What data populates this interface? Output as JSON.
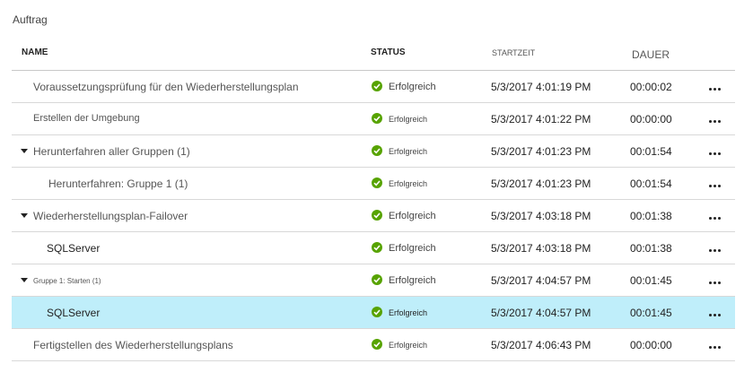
{
  "title": "Auftrag",
  "columns": {
    "name": "NAME",
    "status": "STATUS",
    "start": "STARTZEIT",
    "duration": "DAUER"
  },
  "rows": [
    {
      "name": "Voraussetzungsprüfung für den Wiederherstellungsplan",
      "status": "Erfolgreich",
      "start": "5/3/2017 4:01:19 PM",
      "duration": "00:00:02"
    },
    {
      "name": "Erstellen der Umgebung",
      "status": "Erfolgreich",
      "start": "5/3/2017 4:01:22 PM",
      "duration": "00:00:00"
    },
    {
      "name": "Herunterfahren aller Gruppen (1)",
      "status": "Erfolgreich",
      "start": "5/3/2017 4:01:23 PM",
      "duration": "00:01:54"
    },
    {
      "name": "Herunterfahren: Gruppe 1 (1)",
      "status": "Erfolgreich",
      "start": "5/3/2017 4:01:23 PM",
      "duration": "00:01:54"
    },
    {
      "name": "Wiederherstellungsplan-Failover",
      "status": "Erfolgreich",
      "start": "5/3/2017 4:03:18 PM",
      "duration": "00:01:38"
    },
    {
      "name": "SQLServer",
      "status": "Erfolgreich",
      "start": "5/3/2017 4:03:18 PM",
      "duration": "00:01:38"
    },
    {
      "name": "Gruppe 1: Starten (1)",
      "status": "Erfolgreich",
      "start": "5/3/2017 4:04:57 PM",
      "duration": "00:01:45"
    },
    {
      "name": "SQLServer",
      "status": "Erfolgreich",
      "start": "5/3/2017 4:04:57 PM",
      "duration": "00:01:45"
    },
    {
      "name": "Fertigstellen des Wiederherstellungsplans",
      "status": "Erfolgreich",
      "start": "5/3/2017 4:06:43 PM",
      "duration": "00:00:00"
    }
  ],
  "colors": {
    "success": "#57a300",
    "selected_row": "#bfeefa"
  },
  "icons": {
    "status": "check-circle-icon",
    "expand": "caret-down-icon",
    "more": "ellipsis-icon"
  }
}
